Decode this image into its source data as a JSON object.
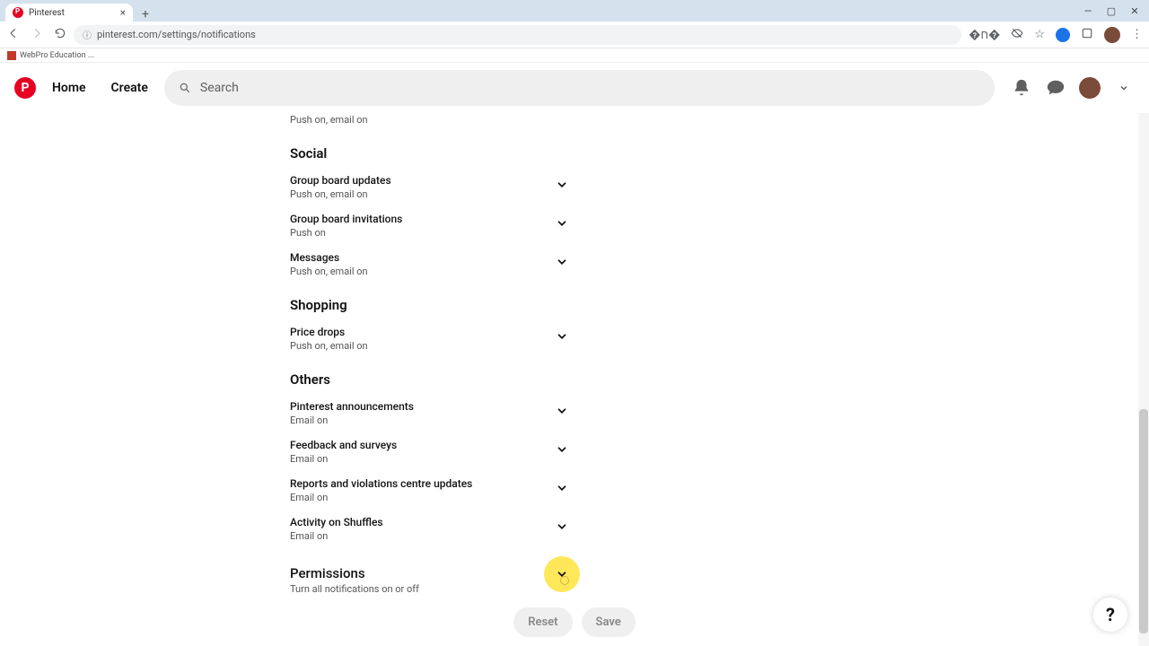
{
  "browser": {
    "tab_title": "Pinterest",
    "url": "pinterest.com/settings/notifications",
    "bookmark_label": "WebPro Education ..."
  },
  "nav": {
    "home": "Home",
    "create": "Create",
    "search_placeholder": "Search"
  },
  "top_status": "Push on, email on",
  "sections": [
    {
      "title": "Social",
      "items": [
        {
          "label": "Group board updates",
          "status": "Push on, email on"
        },
        {
          "label": "Group board invitations",
          "status": "Push on"
        },
        {
          "label": "Messages",
          "status": "Push on, email on"
        }
      ]
    },
    {
      "title": "Shopping",
      "items": [
        {
          "label": "Price drops",
          "status": "Push on, email on"
        }
      ]
    },
    {
      "title": "Others",
      "items": [
        {
          "label": "Pinterest announcements",
          "status": "Email on"
        },
        {
          "label": "Feedback and surveys",
          "status": "Email on"
        },
        {
          "label": "Reports and violations centre updates",
          "status": "Email on"
        },
        {
          "label": "Activity on Shuffles",
          "status": "Email on"
        }
      ]
    }
  ],
  "permissions": {
    "title": "Permissions",
    "subtitle": "Turn all notifications on or off"
  },
  "footer": {
    "reset": "Reset",
    "save": "Save"
  },
  "help": "?"
}
